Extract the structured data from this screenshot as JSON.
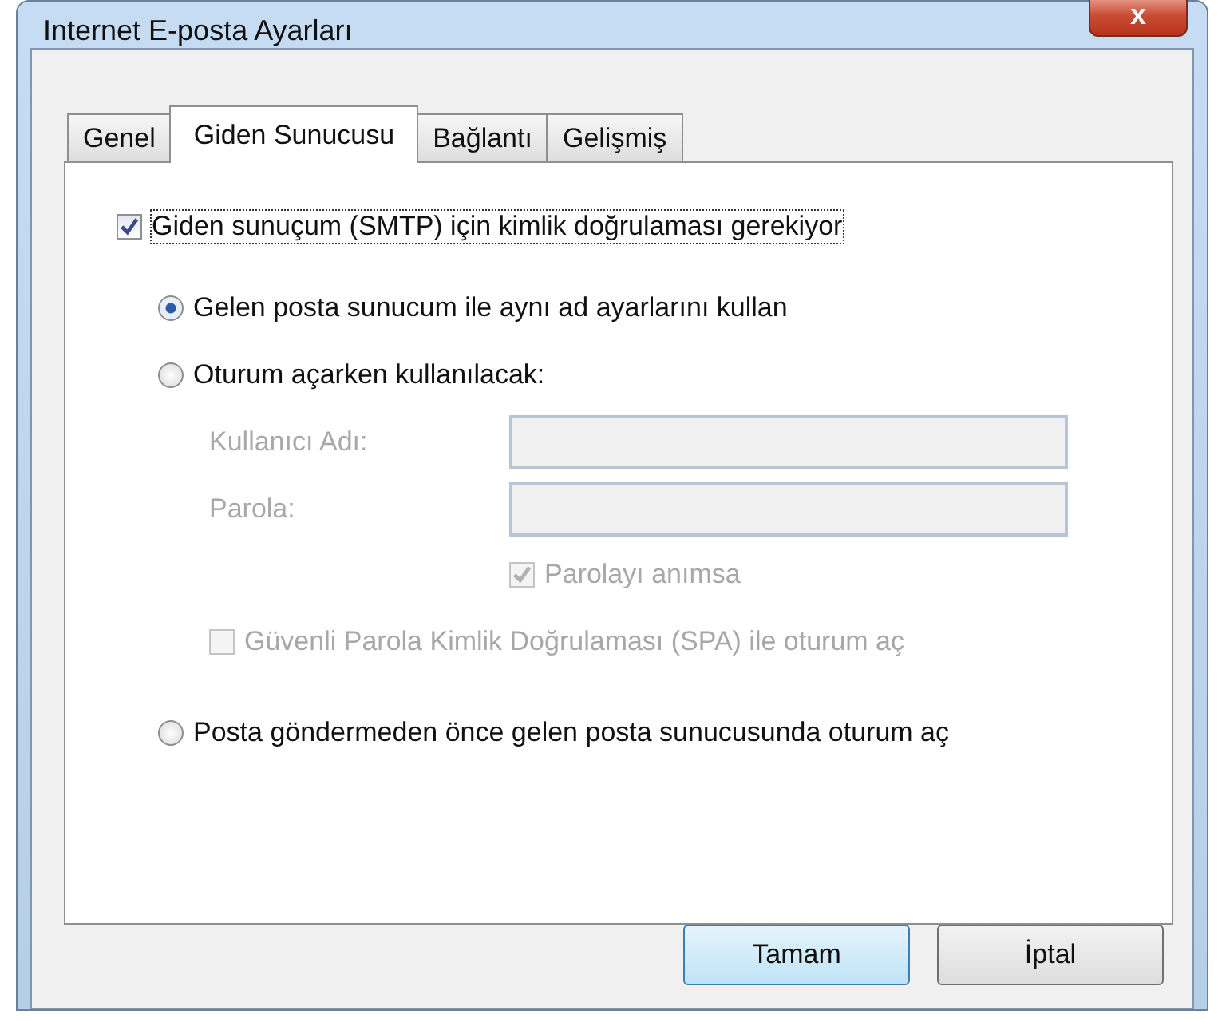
{
  "window": {
    "title": "Internet E-posta Ayarları",
    "close": "x"
  },
  "tabs": [
    {
      "label": "Genel",
      "selected": false
    },
    {
      "label": "Giden Sunucusu",
      "selected": true
    },
    {
      "label": "Bağlantı",
      "selected": false
    },
    {
      "label": "Gelişmiş",
      "selected": false
    }
  ],
  "smtp_auth": {
    "label": "Giden sunuçum (SMTP) için kimlik doğrulaması gerekiyor",
    "checked": true
  },
  "login_options": [
    {
      "label": "Gelen posta sunucum ile aynı ad ayarlarını kullan",
      "selected": true
    },
    {
      "label": "Oturum açarken kullanılacak:",
      "selected": false
    }
  ],
  "fields": [
    {
      "label": "Kullanıcı Adı:",
      "disabled": true
    },
    {
      "label": "Parola:",
      "disabled": true
    }
  ],
  "remember_password": {
    "label": "Parolayı anımsa",
    "checked": true,
    "disabled": true
  },
  "spa": {
    "label": "Güvenli Parola Kimlik Doğrulaması (SPA) ile oturum aç",
    "checked": false,
    "disabled": true
  },
  "send_option": {
    "label": "Posta göndermeden önce gelen posta sunucusunda oturum aç",
    "selected": false
  },
  "buttons": [
    {
      "label": "Tamam",
      "kind": "default"
    },
    {
      "label": "İptal",
      "kind": "normal"
    }
  ]
}
